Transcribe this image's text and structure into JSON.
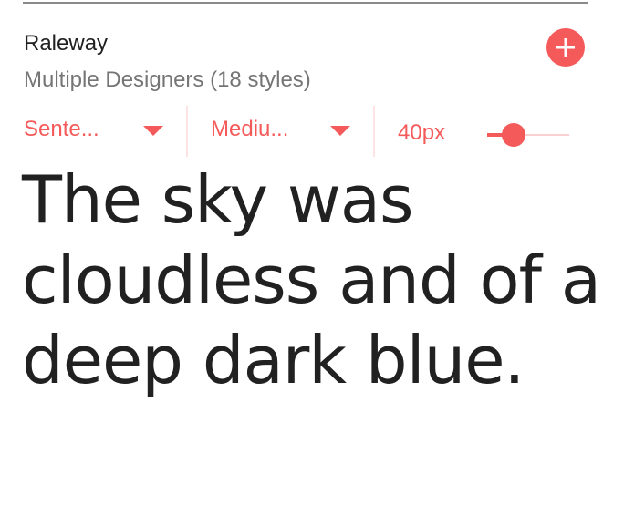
{
  "font": {
    "name": "Raleway",
    "designers": "Multiple Designers (18 styles)"
  },
  "actions": {
    "add_icon": "plus-icon",
    "accent_color": "#f55a5a"
  },
  "controls": {
    "case_dropdown": {
      "value": "Sente...",
      "icon": "chevron-down-icon"
    },
    "weight_dropdown": {
      "value": "Mediu...",
      "icon": "chevron-down-icon"
    },
    "size": {
      "label": "40px",
      "slider_value_fraction": 0.32
    }
  },
  "sample": {
    "text": "The sky was cloudless and of a deep dark blue."
  }
}
